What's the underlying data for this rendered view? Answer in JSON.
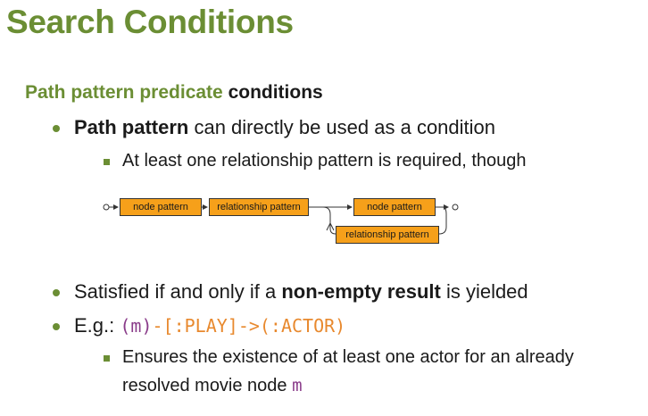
{
  "slide": {
    "title": "Search Conditions",
    "subhead_a": "Path pattern predicate ",
    "subhead_b": "conditions"
  },
  "bullets": {
    "b1_bold": "Path pattern",
    "b1_rest": " can directly be used as a condition",
    "b1_sub": "At least one relationship pattern is required, though",
    "b2_pre": "Satisfied if and only if a ",
    "b2_bold": "non-empty result",
    "b2_post": " is yielded",
    "b3_pre": "E.g.: ",
    "b3_code_var": "(m)",
    "b3_code_rest": "-[:PLAY]->(:ACTOR)",
    "b3_sub_line1": "Ensures the existence of at least one actor for an already",
    "b3_sub_line2": "resolved movie node ",
    "b3_sub_code": "m"
  },
  "diagram": {
    "node_pattern_1": "node pattern",
    "relationship_pattern_1": "relationship pattern",
    "node_pattern_2": "node pattern",
    "relationship_pattern_2": "relationship pattern"
  },
  "colors": {
    "accent_green": "#6b8e34",
    "box_orange": "#f6a01a",
    "code_purple": "#8a3c8a",
    "code_orange": "#e8892e"
  }
}
